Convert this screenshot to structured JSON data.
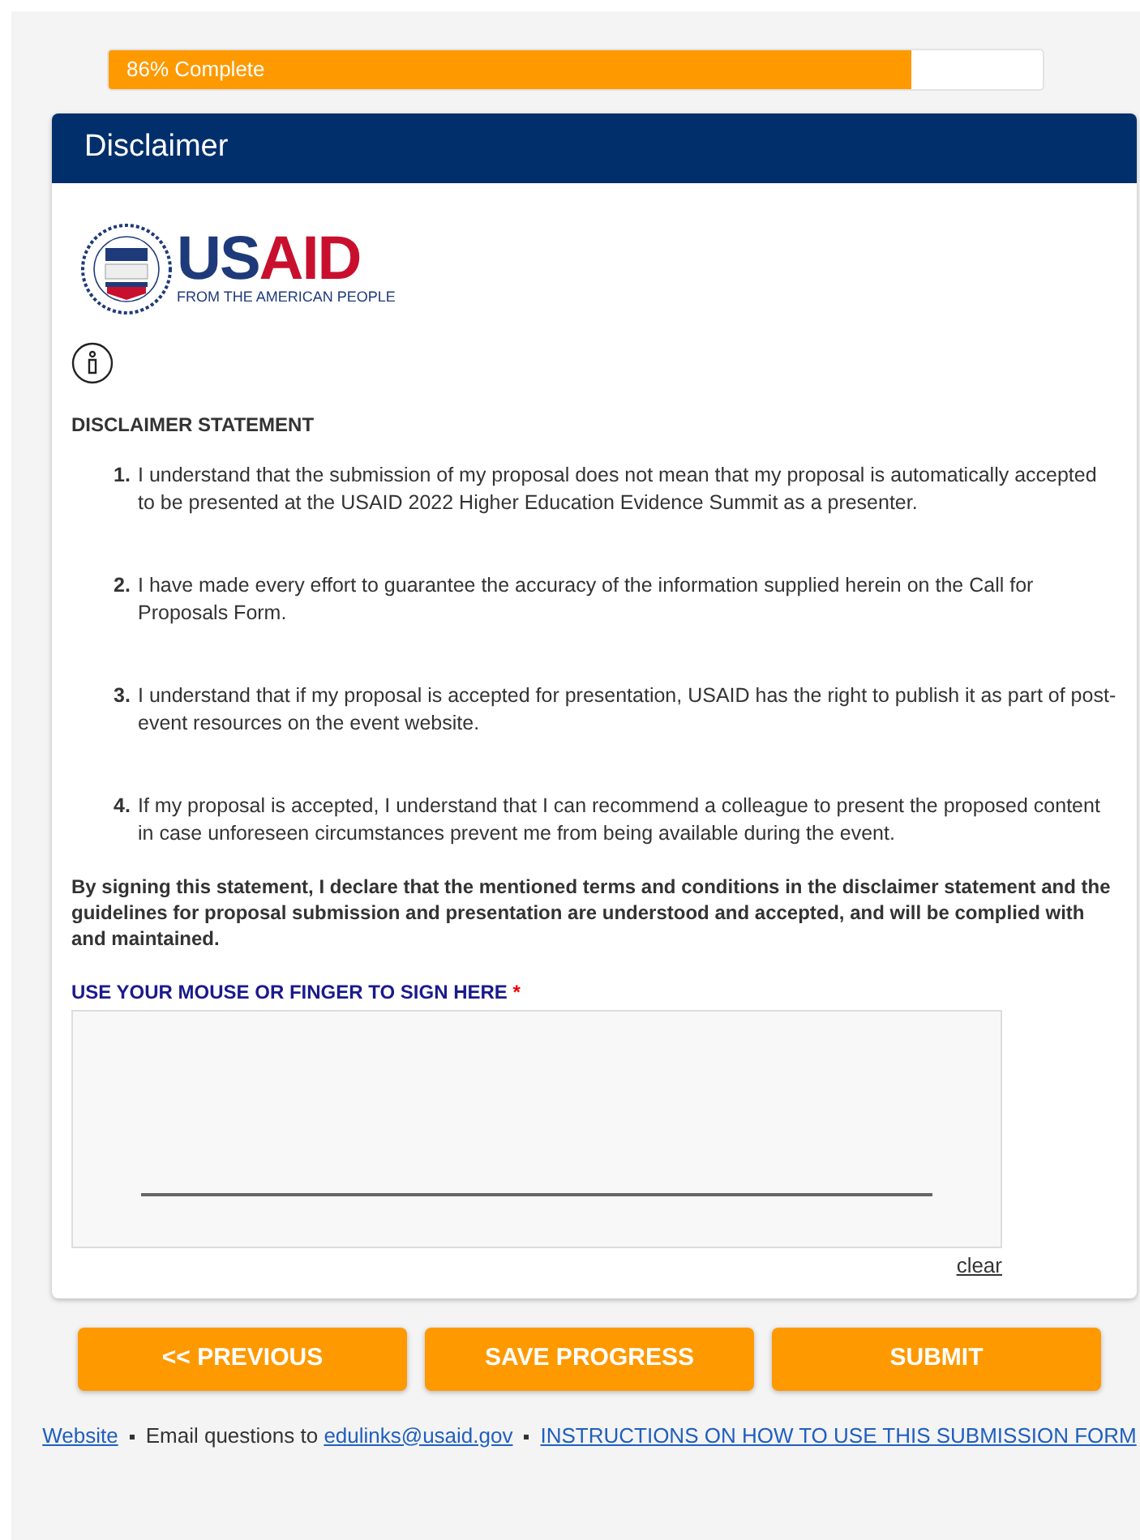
{
  "progress": {
    "label": "86% Complete",
    "level": 0.86
  },
  "card": {
    "title": "Disclaimer",
    "logo": {
      "wordmark": [
        "US",
        "AID"
      ],
      "tagline": "FROM THE AMERICAN PEOPLE"
    },
    "heading": "DISCLAIMER STATEMENT",
    "statements": [
      {
        "number": "1.",
        "text": "I understand that the submission of my proposal does not mean that my proposal is automatically accepted to be presented at the USAID 2022 Higher Education Evidence Summit as a presenter."
      },
      {
        "number": "2.",
        "text": "I have made every effort to guarantee the accuracy of the information supplied herein on the Call for Proposals Form."
      },
      {
        "number": "3.",
        "text": "I understand that if my proposal is accepted for presentation, USAID has the right to publish it as part of post-event resources on the event website."
      },
      {
        "number": "4.",
        "text": "If my proposal is accepted, I understand that I can recommend a colleague to present the proposed content in case unforeseen circumstances prevent me from being available during the event."
      }
    ],
    "declaration": "By signing this statement, I declare that the mentioned terms and conditions in the disclaimer statement and the guidelines for proposal submission and presentation are understood and accepted, and will be complied with and maintained.",
    "signature": {
      "label": "USE YOUR MOUSE OR FINGER TO SIGN HERE",
      "required_mark": "*",
      "clear": "clear"
    }
  },
  "buttons": [
    "<< PREVIOUS",
    "SAVE PROGRESS",
    "SUBMIT"
  ],
  "footer": [
    {
      "kind": "link",
      "text": "Website"
    },
    {
      "kind": "separator"
    },
    {
      "kind": "text",
      "text": "Email questions to "
    },
    {
      "kind": "link",
      "text": "edulinks@usaid.gov"
    },
    {
      "kind": "separator"
    },
    {
      "kind": "link",
      "text": "INSTRUCTIONS ON HOW TO USE THIS SUBMISSION FORM"
    }
  ]
}
